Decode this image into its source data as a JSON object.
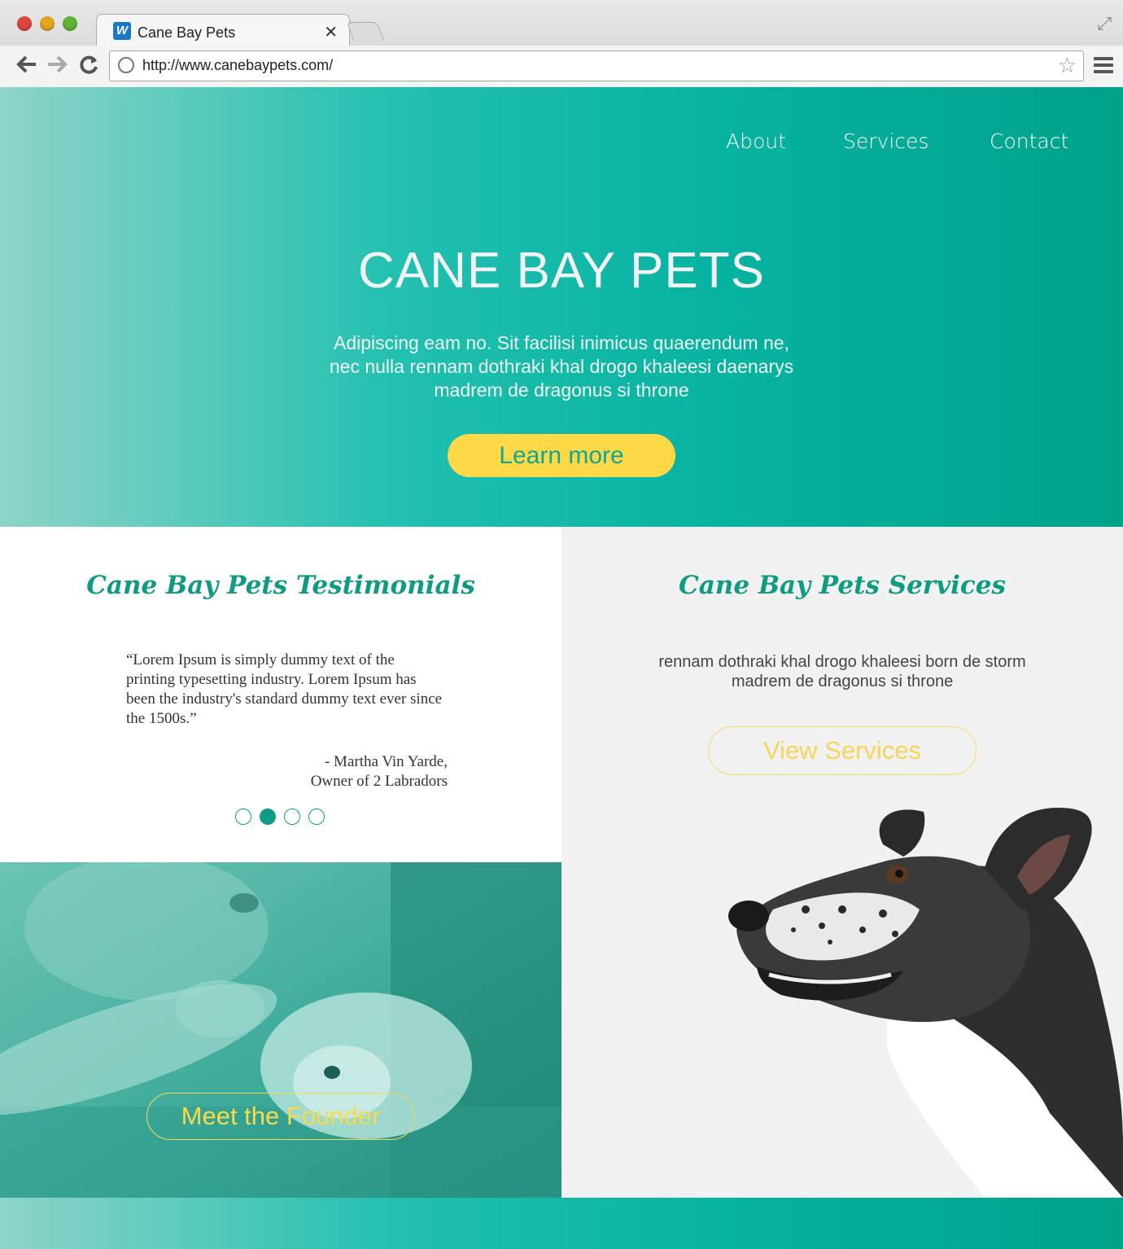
{
  "browser": {
    "tab_title": "Cane Bay Pets",
    "favicon_letter": "W",
    "close_glyph": "✕",
    "url": "http://www.canebaypets.com/",
    "icons": [
      "back-icon",
      "forward-icon",
      "reload-icon",
      "globe-icon",
      "star-icon",
      "menu-icon",
      "fullscreen-icon"
    ]
  },
  "nav": {
    "about": "About",
    "services": "Services",
    "contact": "Contact"
  },
  "hero": {
    "title": "CANE BAY PETS",
    "subtitle": "Adipiscing eam no. Sit facilisi inimicus quaerendum ne, nec nulla rennam dothraki khal drogo khaleesi daenarys madrem de dragonus si throne",
    "cta": "Learn more"
  },
  "testimonials": {
    "heading": "Cane Bay Pets Testimonials",
    "quote": "“Lorem Ipsum is simply dummy text of the printing typesetting industry. Lorem Ipsum has been the industry's standard dummy text ever since the 1500s.”",
    "author_line1": "- Martha Vin Yarde,",
    "author_line2": "Owner of 2 Labradors",
    "carousel_active_index": 1,
    "carousel_count": 4
  },
  "founder": {
    "cta": "Meet the Founder"
  },
  "services": {
    "heading": "Cane Bay Pets Services",
    "text": "rennam dothraki khal drogo khaleesi born de storm madrem de dragonus si throne",
    "cta": "View Services"
  },
  "colors": {
    "teal": "#00a28a",
    "teal_light": "#8fd4c8",
    "yellow": "#fdd947",
    "heading_green": "#0f9a82"
  }
}
